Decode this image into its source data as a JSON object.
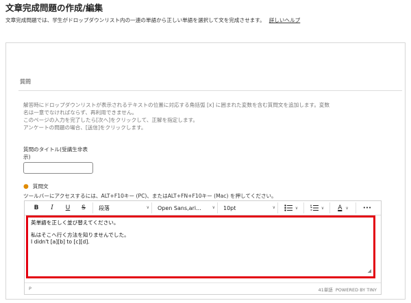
{
  "header": {
    "title": "文章完成問題の作成/編集",
    "description": "文章完成問題では、学生がドロップダウンリスト内の一連の単語から正しい単語を選択して文を完成させます。",
    "help_link": "詳しいヘルプ"
  },
  "section": {
    "label": "質問"
  },
  "instructions": [
    "解答時にドロップダウンリストが表示されるテキストの位置に対応する角括弧 [x] に囲まれた変数を含む質問文を追加します。変数",
    "名は一意でなければならず、再利用できません。",
    "このページの入力を完了したら[次へ]をクリックして、正解を指定します。",
    "アンケートの問題の場合、[送信]をクリックします。"
  ],
  "title_field": {
    "label_line1": "質問のタイトル(受講生非表",
    "label_line2": "示)",
    "value": ""
  },
  "question_text": {
    "label": "質問文",
    "toolbar_hint": "ツールバーにアクセスするには、ALT+F10キー (PC)、またはALT+FN+F10キー (Mac) を押してください。"
  },
  "toolbar": {
    "bold": "B",
    "italic": "I",
    "underline": "U",
    "strike": "S",
    "paragraph": "段落",
    "font": "Open Sans,ari...",
    "size": "10pt",
    "more": "•••"
  },
  "editor_content": {
    "line1": "英単語を正しく並び替えてください。",
    "line2": "私はそこへ行く方法を知りませんでした。",
    "line3": "I didn't [a][b] to [c][d]."
  },
  "statusbar": {
    "path": "P",
    "word_count": "41単語",
    "powered": "POWERED BY TINY"
  },
  "colors": {
    "highlight_border": "#e3000f",
    "required_dot": "#e08a00"
  }
}
